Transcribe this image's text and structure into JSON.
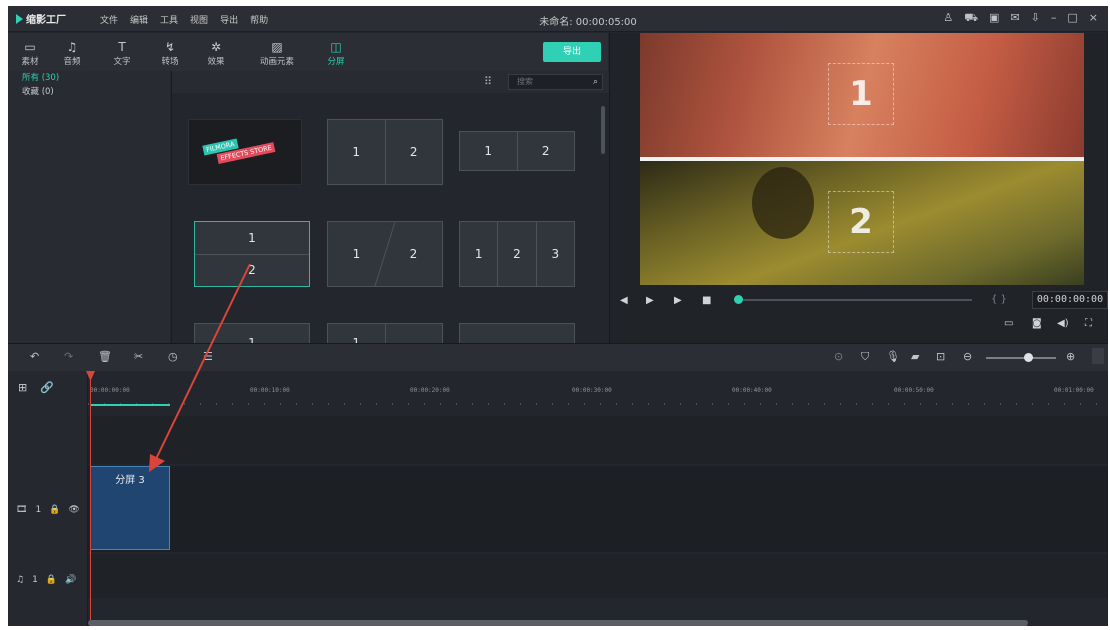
{
  "app": {
    "logo": "缩影工厂",
    "menu": [
      "文件",
      "编辑",
      "工具",
      "视图",
      "导出",
      "帮助"
    ],
    "doc_title": "未命名: 00:00:05:00",
    "window_icons": [
      "user-icon",
      "cart-icon",
      "save-icon",
      "mail-icon",
      "download-icon",
      "minimize-icon",
      "maximize-icon",
      "close-icon"
    ]
  },
  "toolbar": {
    "tabs": [
      {
        "label": "素材",
        "icon": "folder-icon"
      },
      {
        "label": "音频",
        "icon": "music-note-icon"
      },
      {
        "label": "文字",
        "icon": "text-icon"
      },
      {
        "label": "转场",
        "icon": "transition-icon"
      },
      {
        "label": "效果",
        "icon": "effects-icon"
      },
      {
        "label": "动画元素",
        "icon": "image-icon"
      },
      {
        "label": "分屏",
        "icon": "split-screen-icon",
        "active": true
      }
    ],
    "export_label": "导出"
  },
  "sidebar": {
    "items": [
      {
        "label": "所有 (30)",
        "active": true
      },
      {
        "label": "收藏 (0)"
      }
    ]
  },
  "content": {
    "search_placeholder": "搜索",
    "tiles": [
      {
        "id": "filmora-store",
        "type": "promo",
        "line1": "FILMORA",
        "line2": "EFFECTS STORE"
      },
      {
        "id": "split-2v",
        "cells": [
          "1",
          "2"
        ]
      },
      {
        "id": "split-2v-b",
        "cells": [
          "1",
          "2"
        ]
      },
      {
        "id": "split-2h",
        "cells": [
          "1",
          "2"
        ],
        "selected": true
      },
      {
        "id": "split-2d",
        "cells": [
          "1",
          "2"
        ]
      },
      {
        "id": "split-3v",
        "cells": [
          "1",
          "2",
          "3"
        ]
      },
      {
        "id": "split-row3-a",
        "cells": [
          "1"
        ]
      },
      {
        "id": "split-row3-b",
        "cells": [
          "1",
          ""
        ]
      },
      {
        "id": "split-row3-c",
        "cells": [
          "1"
        ]
      }
    ]
  },
  "preview": {
    "top_label": "1",
    "bottom_label": "2",
    "timecode": "00:00:00:00",
    "progress": 0.0,
    "brackets": "{ }"
  },
  "timeline": {
    "toolbar_left": [
      "undo-icon",
      "redo-icon",
      "delete-icon",
      "cut-icon",
      "speed-icon",
      "adjust-icon"
    ],
    "toolbar_right": [
      "render-icon",
      "marker-icon",
      "mic-icon",
      "voiceover-icon",
      "fit-icon",
      "zoom-out-icon",
      "zoom-in-icon"
    ],
    "ruler": [
      "00:00:00:00",
      "00:00:10:00",
      "00:00:20:00",
      "00:00:30:00",
      "00:00:40:00",
      "00:00:50:00",
      "00:01:00:00"
    ],
    "video_track": {
      "label": "1",
      "clip": "分屏 3"
    },
    "audio_track": {
      "label": "1"
    }
  },
  "colors": {
    "accent": "#2fd0b4",
    "clip": "#1f4570",
    "annotation": "#d9453a"
  }
}
